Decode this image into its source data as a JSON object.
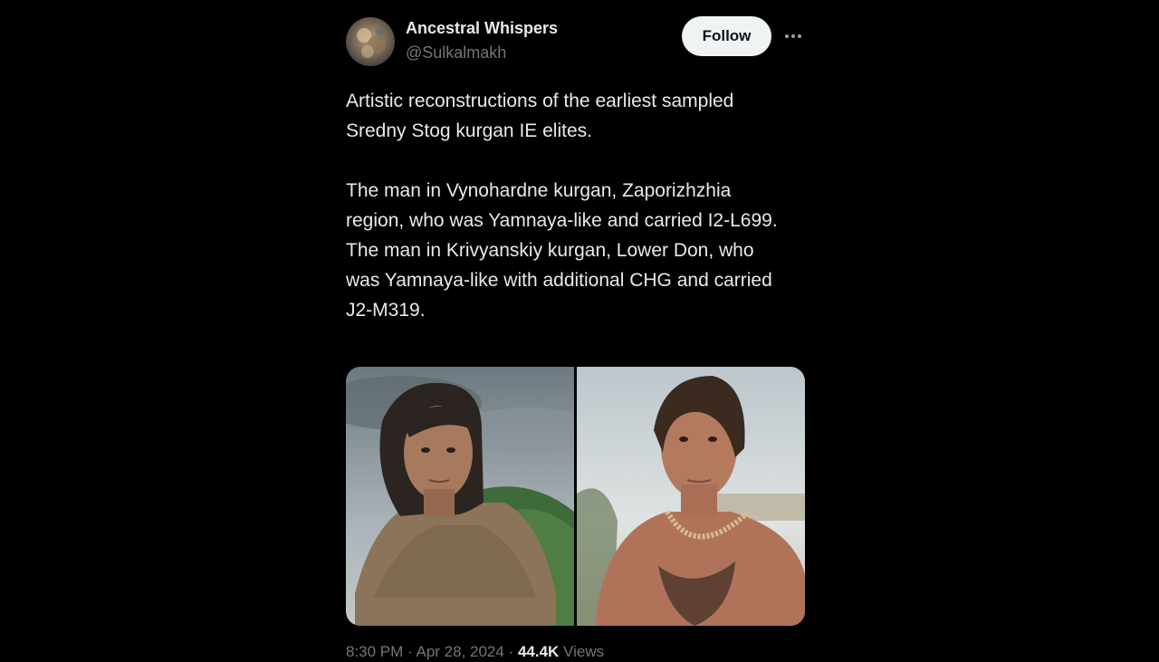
{
  "tweet": {
    "display_name": "Ancestral Whispers",
    "handle": "@Sulkalmakh",
    "follow_label": "Follow",
    "more_icon": "more-horizontal-icon",
    "paragraphs": [
      "Artistic reconstructions of the earliest sampled Sredny Stog kurgan IE elites.",
      "The man in Vynohardne kurgan, Zaporizhzhia region, who was Yamnaya-like and carried I2-L699.\nThe man in Krivyanskiy kurgan, Lower Don, who was Yamnaya-like with additional CHG and carried J2-M319."
    ],
    "media": [
      {
        "name": "reconstruction-vynohradne"
      },
      {
        "name": "reconstruction-krivyanskiy"
      }
    ],
    "meta": {
      "time": "8:30 PM · Apr 28, 2024 · ",
      "views_count": "44.4K",
      "views_label": " Views"
    }
  },
  "colors": {
    "background": "#000000",
    "text": "#e7e9ea",
    "secondary": "#71767b",
    "follow_bg": "#eff3f4"
  }
}
